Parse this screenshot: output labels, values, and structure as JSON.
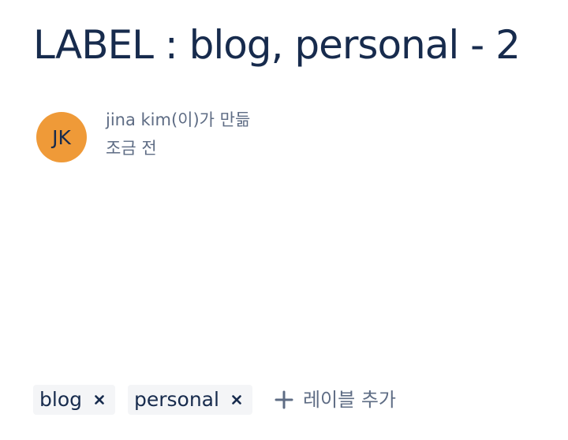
{
  "page": {
    "title": "LABEL : blog, personal - 2"
  },
  "byline": {
    "avatar_initials": "JK",
    "avatar_color": "#ef9a38",
    "created_by": "jina kim(이)가 만듦",
    "timestamp": "조금 전"
  },
  "labels": {
    "items": [
      {
        "text": "blog"
      },
      {
        "text": "personal"
      }
    ],
    "add_label": "레이블 추가",
    "remove_icon": "close-icon",
    "add_icon": "plus-icon"
  }
}
